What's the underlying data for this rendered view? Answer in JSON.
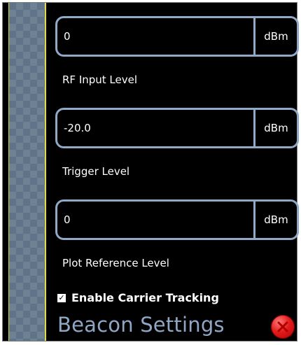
{
  "fields": [
    {
      "value": "0",
      "unit": "dBm",
      "label": "RF Input Level"
    },
    {
      "value": "-20.0",
      "unit": "dBm",
      "label": "Trigger Level"
    },
    {
      "value": "0",
      "unit": "dBm",
      "label": "Plot Reference Level"
    }
  ],
  "options": {
    "enable_carrier_tracking_label": "Enable Carrier Tracking",
    "enable_carrier_tracking_checked": true,
    "check_glyph": "✓"
  },
  "panel": {
    "title": "Beacon Settings"
  },
  "icons": {
    "close": "close-icon"
  },
  "colors": {
    "background": "#000000",
    "accent": "#90a9c6",
    "title": "#8fa6c4",
    "strip": "#5f7488",
    "strip_border": "#e2d84a",
    "close": "#e31b1b"
  }
}
